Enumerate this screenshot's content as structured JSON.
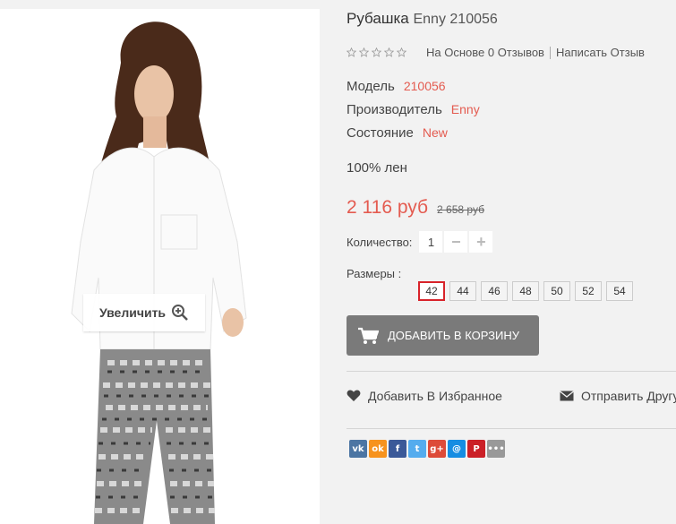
{
  "product": {
    "title_bold": "Рубашка",
    "title_rest": "Enny 210056",
    "rating": {
      "stars_filled": 0,
      "stars_total": 5,
      "reviews_link": "На Основе 0 Отзывов",
      "write_review_link": "Написать Отзыв"
    },
    "specs": [
      {
        "label": "Модель",
        "value": "210056"
      },
      {
        "label": "Производитель",
        "value": "Enny"
      },
      {
        "label": "Состояние",
        "value": "New"
      }
    ],
    "description": "100% лен",
    "price": {
      "current": "2 116 руб",
      "old": "2 658 руб"
    },
    "quantity": {
      "label": "Количество:",
      "value": "1",
      "minus": "−",
      "plus": "+"
    },
    "sizes": {
      "label": "Размеры :",
      "options": [
        "42",
        "44",
        "46",
        "48",
        "50",
        "52",
        "54"
      ],
      "selected": "42"
    },
    "add_to_cart": "ДОБАВИТЬ В КОРЗИНУ",
    "wishlist": "Добавить В Избранное",
    "send_friend": "Отправить Другу",
    "zoom_label": "Увеличить"
  },
  "share": [
    {
      "name": "vk",
      "glyph": "vk",
      "color": "#4c75a3"
    },
    {
      "name": "odnoklassniki",
      "glyph": "ok",
      "color": "#f7931e"
    },
    {
      "name": "facebook",
      "glyph": "f",
      "color": "#3b5998"
    },
    {
      "name": "twitter",
      "glyph": "t",
      "color": "#55acee"
    },
    {
      "name": "google-plus",
      "glyph": "g+",
      "color": "#dd4b39"
    },
    {
      "name": "mail",
      "glyph": "@",
      "color": "#168de2"
    },
    {
      "name": "pinterest",
      "glyph": "P",
      "color": "#cb2027"
    },
    {
      "name": "more",
      "glyph": "•••",
      "color": "#999999"
    }
  ],
  "colors": {
    "accent": "#e45b50",
    "button": "#7a7a7a",
    "size_selected_border": "#d8232a"
  }
}
